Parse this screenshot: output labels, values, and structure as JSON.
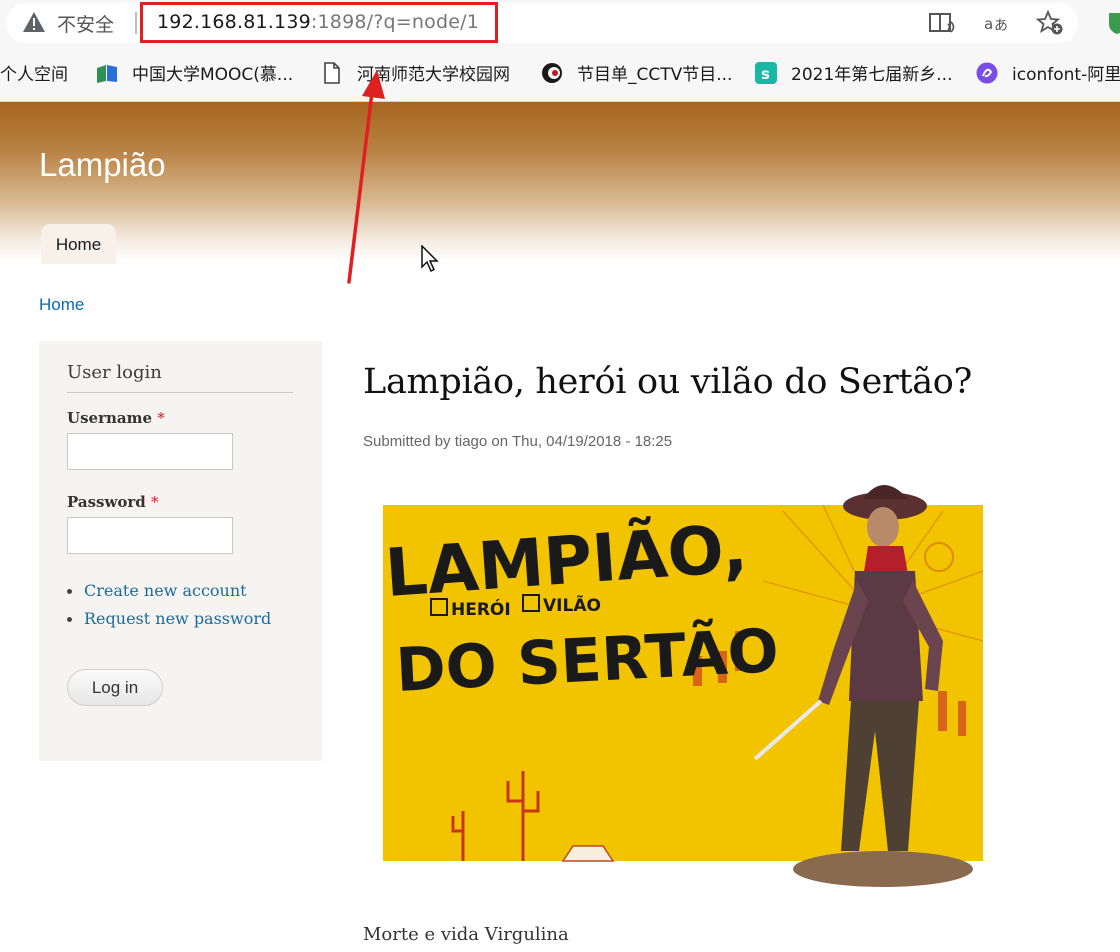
{
  "browser": {
    "security_label": "不安全",
    "url_host": "192.168.81.139",
    "url_rest": ":1898/?q=node/1",
    "toolbar_icons": [
      "read-aloud-icon",
      "translate-icon",
      "add-favorite-icon",
      "shield-extension-icon"
    ],
    "bookmarks": [
      {
        "label": "个人空间",
        "icon": "none"
      },
      {
        "label": "中国大学MOOC(慕...",
        "icon": "mooc-logo-icon"
      },
      {
        "label": "河南师范大学校园网",
        "icon": "page-icon"
      },
      {
        "label": "节目单_CCTV节目...",
        "icon": "cctv-logo-icon"
      },
      {
        "label": "2021年第七届新乡...",
        "icon": "s-logo-icon"
      },
      {
        "label": "iconfont-阿里",
        "icon": "iconfont-logo-icon"
      }
    ]
  },
  "site": {
    "name": "Lampião",
    "nav_home": "Home",
    "breadcrumb": "Home"
  },
  "login": {
    "title": "User login",
    "username_label": "Username",
    "password_label": "Password",
    "required_marker": "*",
    "create_account": "Create new account",
    "request_password": "Request new password",
    "submit": "Log in"
  },
  "article": {
    "title": "Lampião, herói ou vilão do Sertão?",
    "submitted": "Submitted by tiago on Thu, 04/19/2018 - 18:25",
    "poster": {
      "line1": "LAMPIÃO,",
      "option1": "HERÓI",
      "option2": "VILÃO",
      "line2": "DO SERTÃO"
    },
    "body_first_line": "Morte e vida Virgulina"
  },
  "colors": {
    "header_brown": "#a7651f",
    "link_blue": "#0b6ab3",
    "highlight_red": "#e02020",
    "poster_yellow": "#f2c400"
  }
}
